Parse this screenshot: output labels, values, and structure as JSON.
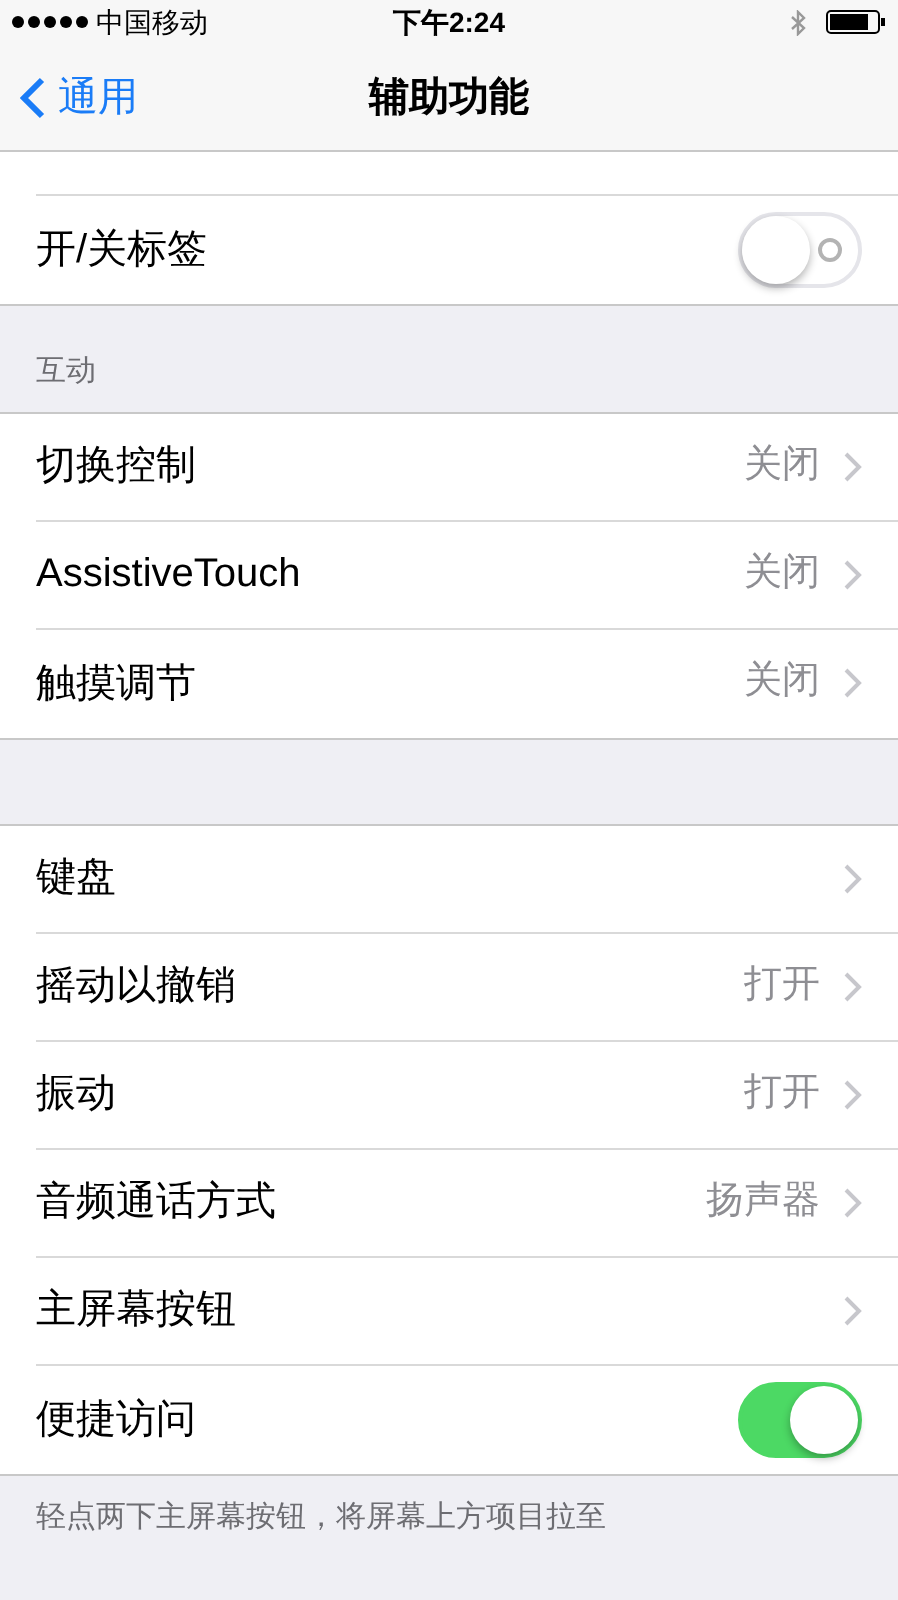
{
  "status_bar": {
    "carrier": "中国移动",
    "time": "下午2:24"
  },
  "nav": {
    "back": "通用",
    "title": "辅助功能"
  },
  "sections": [
    {
      "items": [
        {
          "kind": "partial"
        },
        {
          "kind": "toggle",
          "label": "开/关标签",
          "on": false
        }
      ]
    },
    {
      "header": "互动",
      "items": [
        {
          "kind": "detail",
          "label": "切换控制",
          "value": "关闭"
        },
        {
          "kind": "detail",
          "label": "AssistiveTouch",
          "value": "关闭"
        },
        {
          "kind": "detail",
          "label": "触摸调节",
          "value": "关闭"
        }
      ]
    },
    {
      "items": [
        {
          "kind": "detail",
          "label": "键盘"
        },
        {
          "kind": "detail",
          "label": "摇动以撤销",
          "value": "打开"
        },
        {
          "kind": "detail",
          "label": "振动",
          "value": "打开"
        },
        {
          "kind": "detail",
          "label": "音频通话方式",
          "value": "扬声器"
        },
        {
          "kind": "detail",
          "label": "主屏幕按钮"
        },
        {
          "kind": "toggle",
          "label": "便捷访问",
          "on": true
        }
      ],
      "footer": "轻点两下主屏幕按钮，将屏幕上方项目拉至"
    }
  ]
}
